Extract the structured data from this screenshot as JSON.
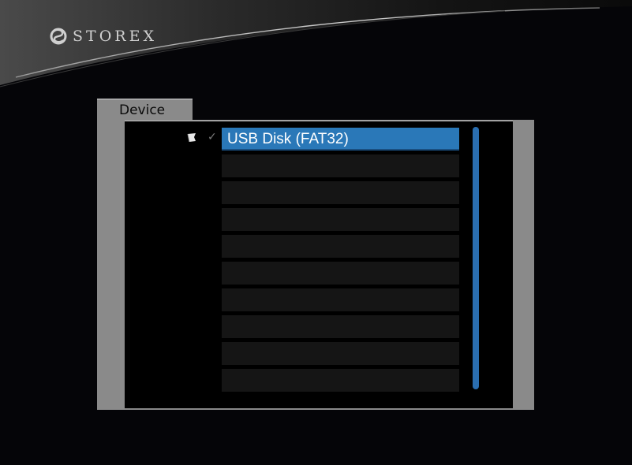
{
  "brand": {
    "name": "STOREX",
    "logo_icon": "storex-logo-icon"
  },
  "device_tab": {
    "label": "Device"
  },
  "device_list": {
    "rows": [
      {
        "label": "USB Disk (FAT32)",
        "selected": true
      },
      {
        "label": "",
        "selected": false
      },
      {
        "label": "",
        "selected": false
      },
      {
        "label": "",
        "selected": false
      },
      {
        "label": "",
        "selected": false
      },
      {
        "label": "",
        "selected": false
      },
      {
        "label": "",
        "selected": false
      },
      {
        "label": "",
        "selected": false
      },
      {
        "label": "",
        "selected": false
      },
      {
        "label": "",
        "selected": false
      }
    ],
    "selected_icons": [
      "folder-icon",
      "check-icon"
    ]
  },
  "colors": {
    "selection": "#2a78b8",
    "frame": "#8a8a8a",
    "scrollbar": "#2a6eb0"
  }
}
